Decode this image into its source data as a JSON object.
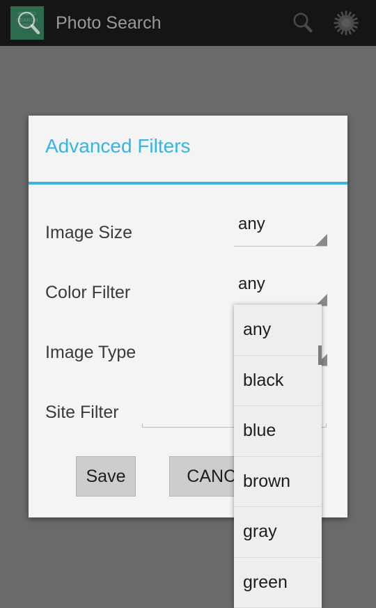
{
  "action_bar": {
    "app_icon": {
      "name": "photo-search-app-icon",
      "badge_text": "PHOTO\nSEARCH\nHOME",
      "background_color": "#2d6b4f"
    },
    "title": "Photo Search",
    "actions": [
      {
        "name": "search-icon",
        "label": "Search"
      },
      {
        "name": "gear-icon",
        "label": "Settings"
      }
    ],
    "background_color": "#151515",
    "title_color": "#9a9a9a"
  },
  "dialog": {
    "title": "Advanced Filters",
    "title_color": "#33b5e5",
    "divider_color": "#3bb3dd",
    "rows": [
      {
        "label": "Image Size",
        "control": "spinner",
        "value": "any"
      },
      {
        "label": "Color Filter",
        "control": "spinner",
        "value": "any"
      },
      {
        "label": "Image Type",
        "control": "spinner",
        "value": ""
      },
      {
        "label": "Site Filter",
        "control": "text",
        "value": "",
        "placeholder": ""
      }
    ],
    "buttons": {
      "save": "Save",
      "cancel": "CANCEL"
    }
  },
  "dropdown": {
    "owner": "Color Filter",
    "items": [
      "any",
      "black",
      "blue",
      "brown",
      "gray",
      "green"
    ]
  },
  "background_color": "#6a6a6a"
}
